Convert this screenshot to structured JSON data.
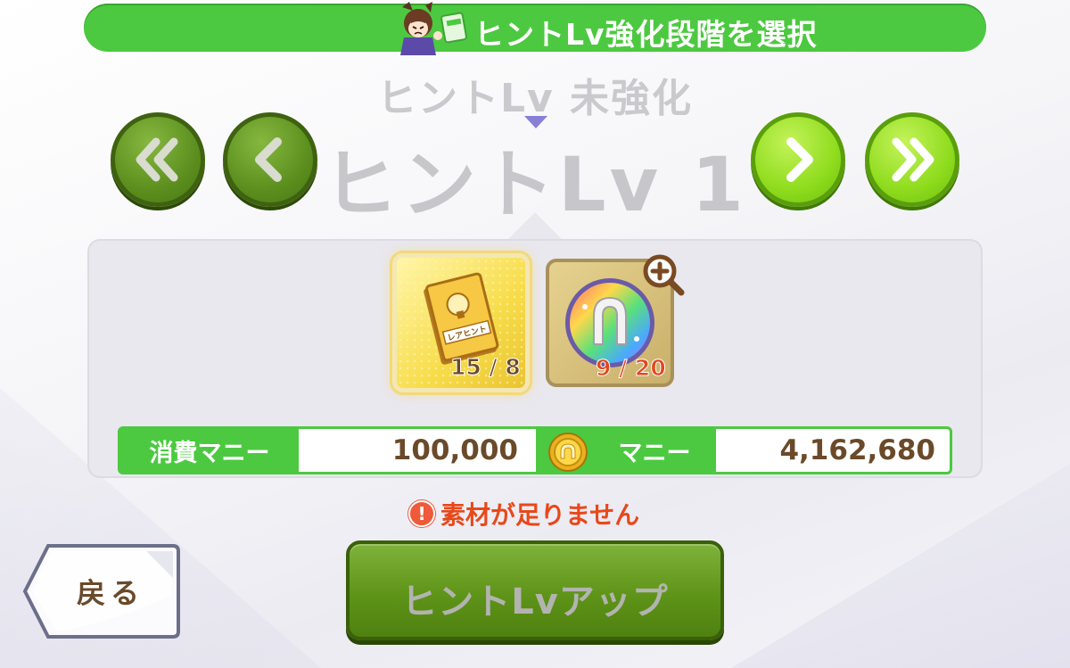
{
  "header": {
    "title": "ヒントLv強化段階を選択"
  },
  "level": {
    "previous": "ヒントLv 未強化",
    "current": "ヒントLv 1"
  },
  "nav": {
    "first_icon": "double-chevron-left-icon",
    "prev_icon": "chevron-left-icon",
    "next_icon": "chevron-right-icon",
    "last_icon": "double-chevron-right-icon"
  },
  "materials": [
    {
      "name": "レアヒント",
      "icon": "rare-hint-book-icon",
      "count_text": "15 / 8",
      "owned": 15,
      "required": 8,
      "sufficient": true,
      "count_color": "#6a4a2a"
    },
    {
      "icon": "rainbow-horseshoe-icon",
      "count_text": "9 / 20",
      "owned": 9,
      "required": 20,
      "sufficient": false,
      "count_color": "#e2481d"
    }
  ],
  "money": {
    "cost_label": "消費マニー",
    "cost_value": "100,000",
    "owned_label": "マニー",
    "owned_value": "4,162,680",
    "coin_icon": "money-coin-icon"
  },
  "warning": {
    "icon": "exclamation-icon",
    "text": "素材が足りません"
  },
  "buttons": {
    "back_label": "戻る",
    "level_up_label": "ヒントLvアップ"
  },
  "colors": {
    "accent_green": "#4cc940",
    "warning_red": "#e8481a",
    "text_brown": "#6a4a2a"
  }
}
